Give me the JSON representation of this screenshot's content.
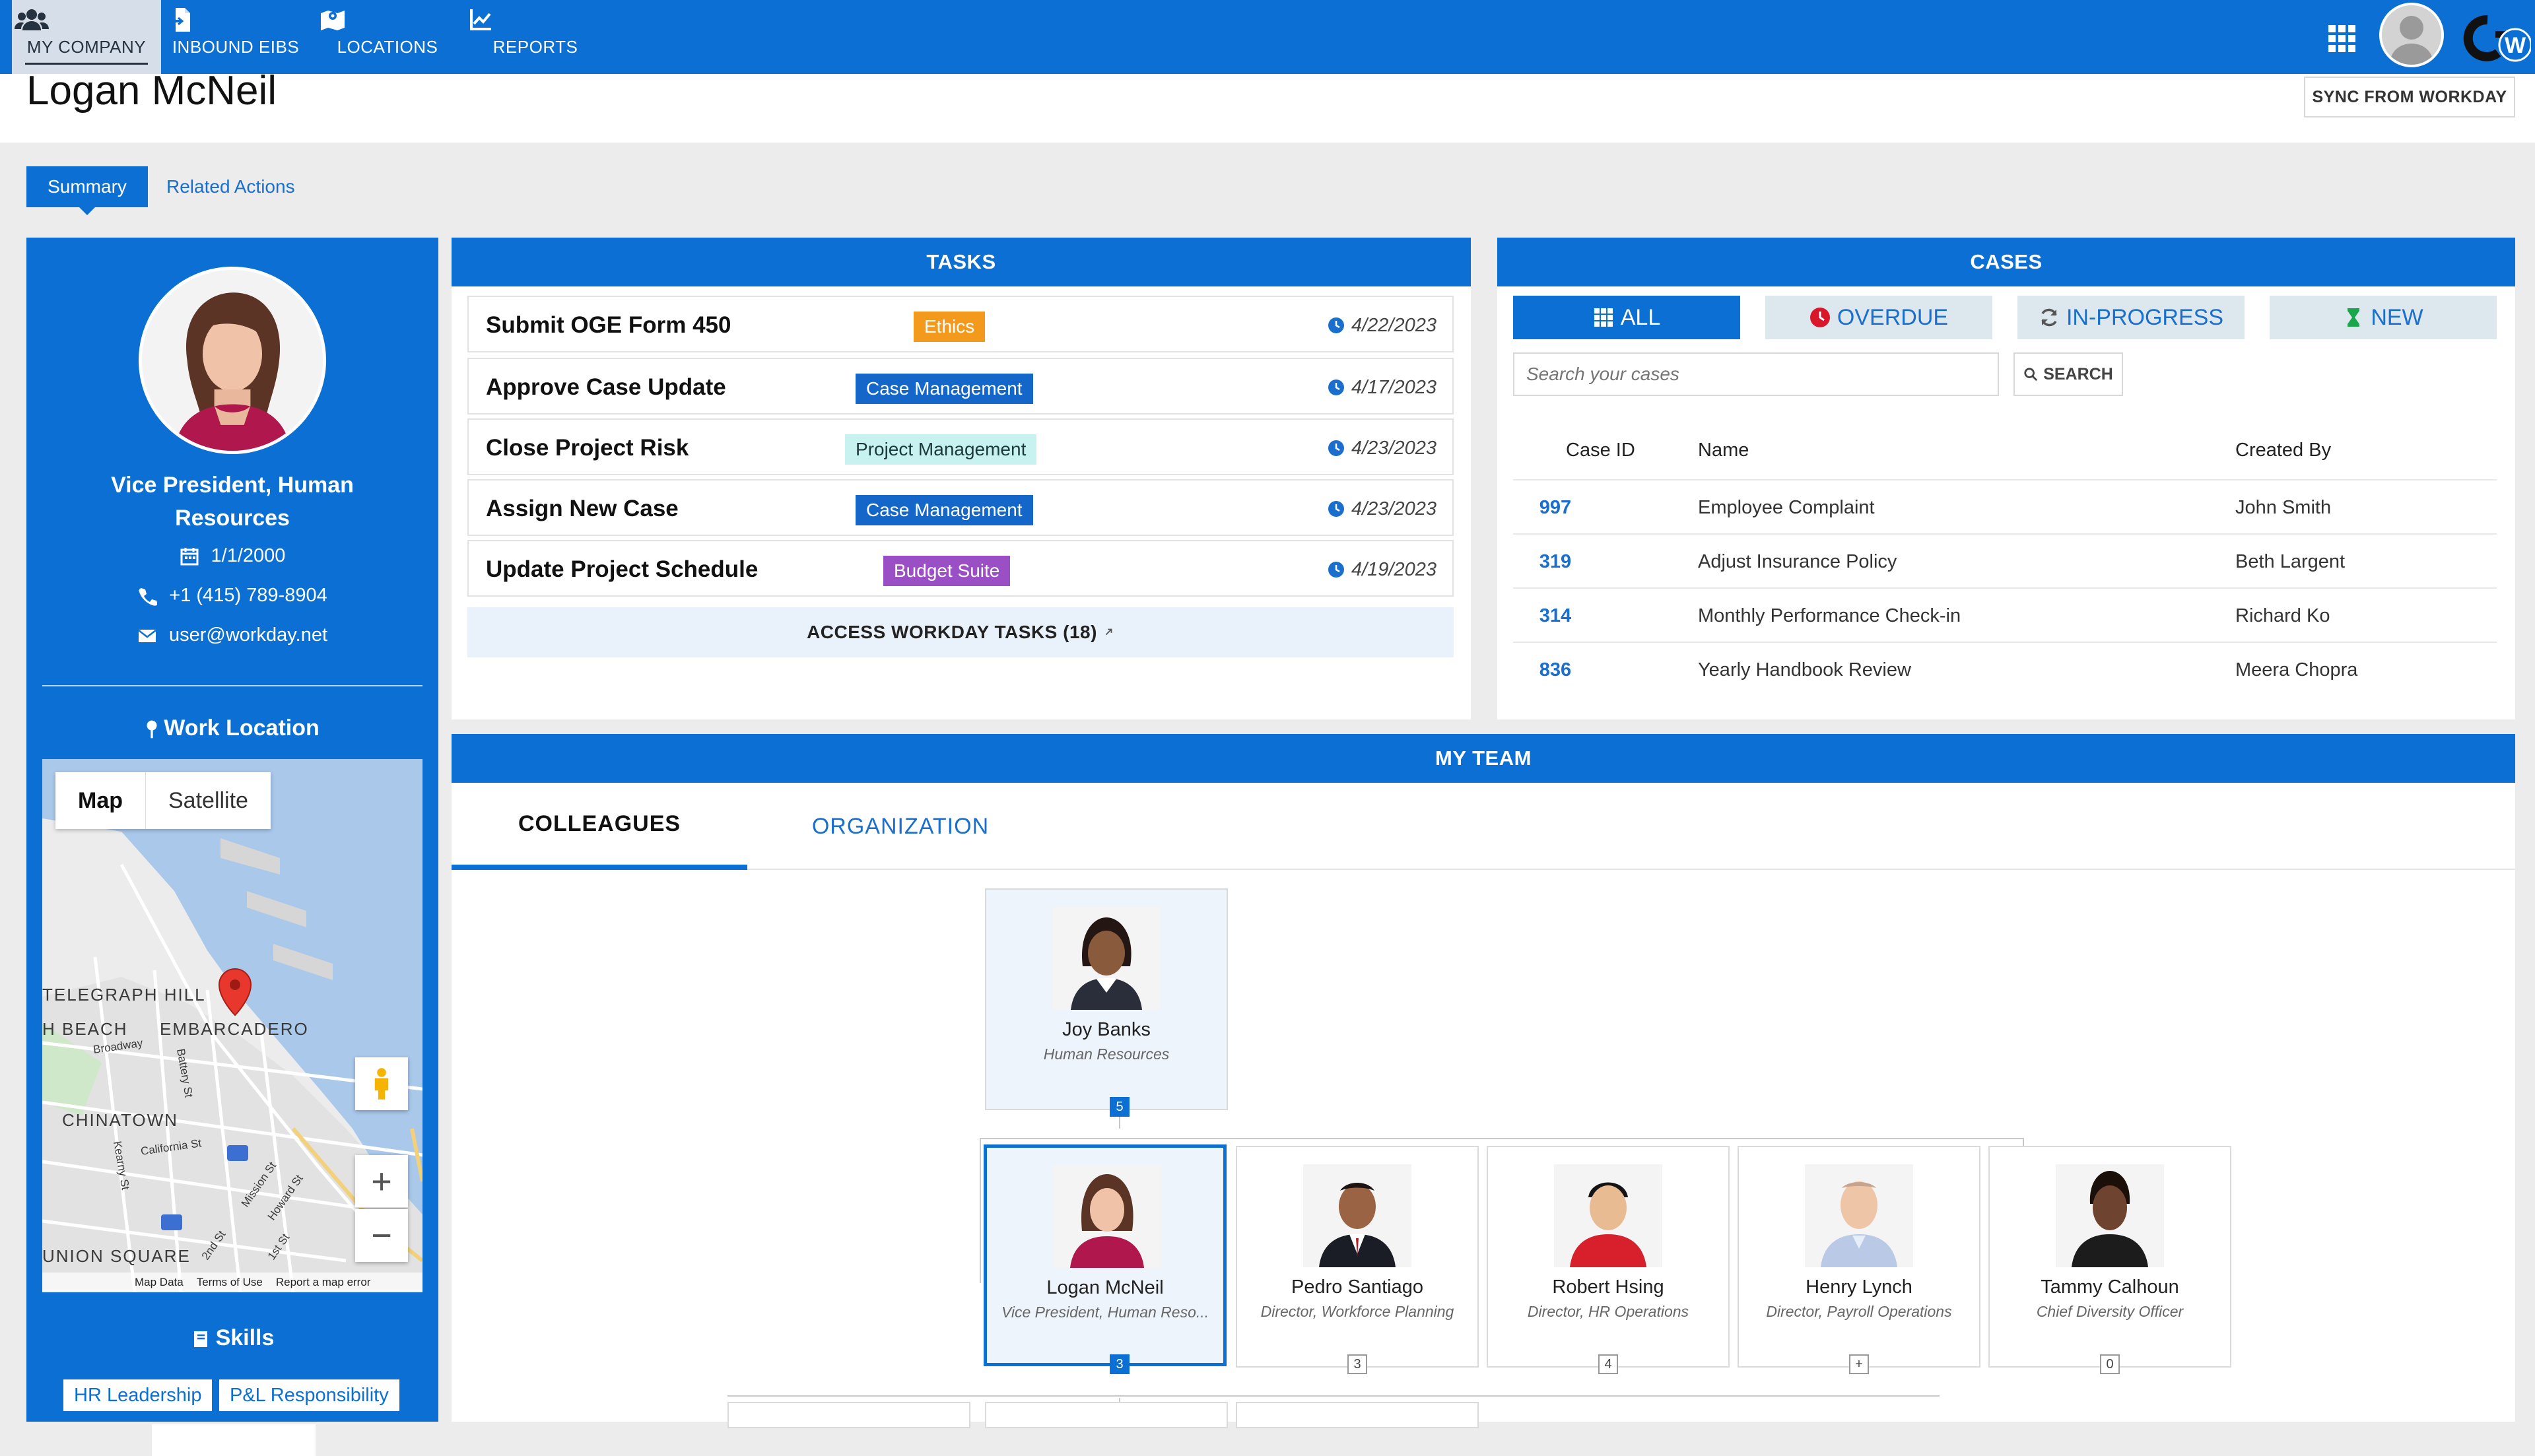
{
  "nav": {
    "items": [
      {
        "label": "MY COMPANY",
        "icon": "users-icon",
        "active": true
      },
      {
        "label": "INBOUND EIBS",
        "icon": "file-import-icon",
        "active": false
      },
      {
        "label": "LOCATIONS",
        "icon": "map-icon",
        "active": false
      },
      {
        "label": "REPORTS",
        "icon": "chart-line-icon",
        "active": false
      }
    ],
    "logo_text": "W"
  },
  "header": {
    "title": "Logan McNeil",
    "sync_label": "SYNC FROM WORKDAY"
  },
  "tabs": {
    "summary": "Summary",
    "related": "Related Actions"
  },
  "profile": {
    "job_title": "Vice President, Human Resources",
    "date": "1/1/2000",
    "phone": "+1 (415) 789-8904",
    "email": "user@workday.net",
    "work_location_label": "Work Location",
    "skills_label": "Skills",
    "skills": [
      "HR Leadership",
      "P&L Responsibility"
    ]
  },
  "map": {
    "tab_map": "Map",
    "tab_satellite": "Satellite",
    "labels": [
      "TELEGRAPH HILL",
      "H BEACH",
      "EMBARCADERO",
      "CHINATOWN",
      "UNION SQUARE",
      "Broadway",
      "Battery St",
      "California St",
      "Kearny St",
      "Mission St",
      "Howard St",
      "1st St",
      "2nd St"
    ],
    "footer": [
      "Map Data",
      "Terms of Use",
      "Report a map error"
    ]
  },
  "tasks": {
    "title": "TASKS",
    "items": [
      {
        "title": "Submit OGE Form 450",
        "badge": "Ethics",
        "badge_bg": "#f39a1d",
        "badge_fg": "#ffffff",
        "date": "4/22/2023"
      },
      {
        "title": "Approve Case Update",
        "badge": "Case Management",
        "badge_bg": "#1467c8",
        "badge_fg": "#ffffff",
        "date": "4/17/2023"
      },
      {
        "title": "Close Project Risk",
        "badge": "Project Management",
        "badge_bg": "#c7f2ef",
        "badge_fg": "#1d3a3a",
        "date": "4/23/2023"
      },
      {
        "title": "Assign New Case",
        "badge": "Case Management",
        "badge_bg": "#1467c8",
        "badge_fg": "#ffffff",
        "date": "4/23/2023"
      },
      {
        "title": "Update Project Schedule",
        "badge": "Budget Suite",
        "badge_bg": "#9b4fc4",
        "badge_fg": "#ffffff",
        "date": "4/19/2023"
      }
    ],
    "access_label": "ACCESS WORKDAY TASKS (18)"
  },
  "cases": {
    "title": "CASES",
    "filters": {
      "all": "ALL",
      "overdue": "OVERDUE",
      "in_progress": "IN-PROGRESS",
      "new": "NEW"
    },
    "search_placeholder": "Search your cases",
    "search_button": "SEARCH",
    "columns": {
      "id": "Case ID",
      "name": "Name",
      "created_by": "Created By"
    },
    "rows": [
      {
        "id": "997",
        "name": "Employee Complaint",
        "created_by": "John Smith"
      },
      {
        "id": "319",
        "name": "Adjust Insurance Policy",
        "created_by": "Beth Largent"
      },
      {
        "id": "314",
        "name": "Monthly Performance Check-in",
        "created_by": "Richard Ko"
      },
      {
        "id": "836",
        "name": "Yearly Handbook Review",
        "created_by": "Meera Chopra"
      }
    ]
  },
  "team": {
    "title": "MY TEAM",
    "tab_colleagues": "COLLEAGUES",
    "tab_organization": "ORGANIZATION",
    "manager": {
      "name": "Joy Banks",
      "role": "Human Resources",
      "count": "5"
    },
    "members": [
      {
        "name": "Logan McNeil",
        "role": "Vice President, Human Reso...",
        "count": "3"
      },
      {
        "name": "Pedro Santiago",
        "role": "Director, Workforce Planning",
        "count": "3"
      },
      {
        "name": "Robert Hsing",
        "role": "Director, HR Operations",
        "count": "4"
      },
      {
        "name": "Henry Lynch",
        "role": "Director, Payroll Operations",
        "count": "+"
      },
      {
        "name": "Tammy Calhoun",
        "role": "Chief Diversity Officer",
        "count": "0"
      }
    ]
  }
}
